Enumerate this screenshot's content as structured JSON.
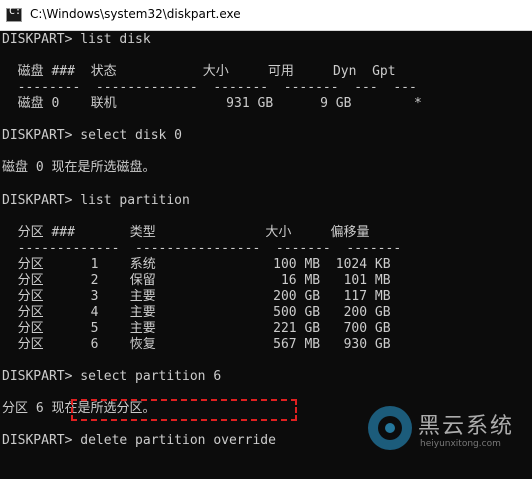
{
  "window": {
    "title": "C:\\Windows\\system32\\diskpart.exe"
  },
  "console": {
    "lines": [
      "DISKPART> list disk",
      "",
      "  磁盘 ###  状态           大小     可用     Dyn  Gpt",
      "  --------  -------------  -------  -------  ---  ---",
      "  磁盘 0    联机              931 GB      9 GB        *",
      "",
      "DISKPART> select disk 0",
      "",
      "磁盘 0 现在是所选磁盘。",
      "",
      "DISKPART> list partition",
      "",
      "  分区 ###       类型              大小     偏移量",
      "  -------------  ----------------  -------  -------",
      "  分区      1    系统               100 MB  1024 KB",
      "  分区      2    保留                16 MB   101 MB",
      "  分区      3    主要               200 GB   117 MB",
      "  分区      4    主要               500 GB   200 GB",
      "  分区      5    主要               221 GB   700 GB",
      "  分区      6    恢复               567 MB   930 GB",
      "",
      "DISKPART> select partition 6",
      "",
      "分区 6 现在是所选分区。",
      "",
      "DISKPART> delete partition override"
    ]
  },
  "annotation": {
    "highlight_color": "#e02020"
  },
  "watermark": {
    "brand": "黑云系统",
    "url": "heiyunxitong.com"
  }
}
